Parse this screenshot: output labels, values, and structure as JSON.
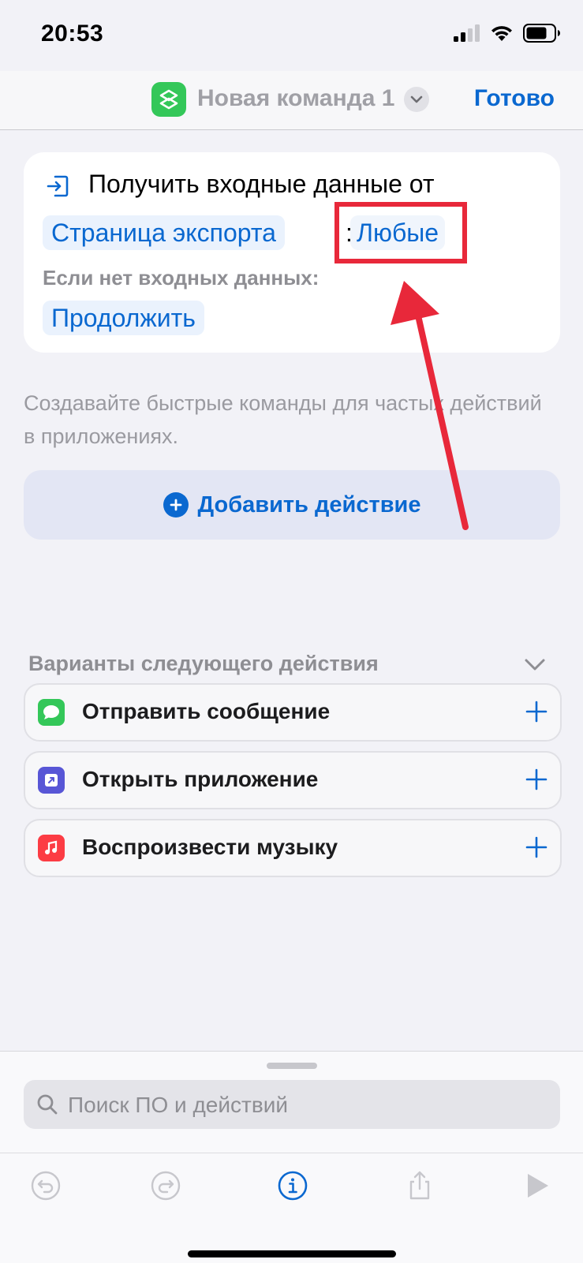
{
  "status_bar": {
    "time": "20:53"
  },
  "nav": {
    "title": "Новая команда 1",
    "done_label": "Готово"
  },
  "action": {
    "title": "Получить входные данные от",
    "source_token": "Страница экспорта",
    "separator": ":",
    "type_token": "Любые",
    "no_input_label": "Если нет входных данных:",
    "no_input_value": "Продолжить"
  },
  "hint": "Создавайте быстрые команды для частых действий в приложениях.",
  "add_action_label": "Добавить действие",
  "suggestions": {
    "header": "Варианты следующего действия",
    "items": [
      {
        "label": "Отправить сообщение",
        "icon": "messages-icon",
        "color": "#34C759"
      },
      {
        "label": "Открыть приложение",
        "icon": "open-app-icon",
        "color": "#5856D6"
      },
      {
        "label": "Воспроизвести музыку",
        "icon": "music-icon",
        "color": "#FC3C44"
      }
    ]
  },
  "search": {
    "placeholder": "Поиск ПО и действий"
  },
  "colors": {
    "accent": "#0A68D0",
    "annotation": "#E8283A",
    "app_green": "#34C759"
  }
}
